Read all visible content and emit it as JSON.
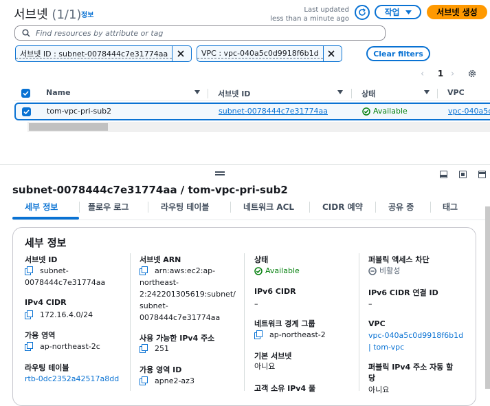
{
  "header": {
    "title": "서브넷",
    "count": "(1/1)",
    "info_link": "정보",
    "updated_line1": "Last updated",
    "updated_line2": "less than a minute ago",
    "actions_label": "작업",
    "create_label": "서브넷 생성"
  },
  "search": {
    "placeholder": "Find resources by attribute or tag"
  },
  "filters": {
    "tokens": [
      {
        "label": "서브넷 ID : subnet-0078444c7e31774aa"
      },
      {
        "label": "VPC : vpc-040a5c0d9918f6b1d"
      }
    ],
    "clear_label": "Clear filters"
  },
  "pagination": {
    "current_page": "1"
  },
  "table": {
    "columns": [
      "Name",
      "서브넷 ID",
      "상태",
      "VPC"
    ],
    "rows": [
      {
        "name": "tom-vpc-pri-sub2",
        "subnet_id": "subnet-0078444c7e31774aa",
        "state": "Available",
        "vpc": "vpc-040a5c"
      }
    ]
  },
  "detail": {
    "title": "subnet-0078444c7e31774aa / tom-vpc-pri-sub2",
    "tabs": [
      "세부 정보",
      "플로우 로그",
      "라우팅 테이블",
      "네트워크 ACL",
      "CIDR 예약",
      "공유 중",
      "태그"
    ],
    "section_title": "세부 정보",
    "col1": {
      "subnet_id_label": "서브넷 ID",
      "subnet_id_line1": "subnet-",
      "subnet_id_line2": "0078444c7e31774aa",
      "ipv4_cidr_label": "IPv4 CIDR",
      "ipv4_cidr": "172.16.4.0/24",
      "az_label": "가용 영역",
      "az": "ap-northeast-2c",
      "route_table_label": "라우팅 테이블",
      "route_table": "rtb-0dc2352a42517a8dd"
    },
    "col2": {
      "arn_label": "서브넷 ARN",
      "arn_line1": "arn:aws:ec2:ap-",
      "arn_line2": "northeast-",
      "arn_line3": "2:242201305619:subnet/",
      "arn_line4": "subnet-",
      "arn_line5": "0078444c7e31774aa",
      "avail_ipv4_label": "사용 가능한 IPv4 주소",
      "avail_ipv4": "251",
      "az_id_label": "가용 영역 ID",
      "az_id": "apne2-az3"
    },
    "col3": {
      "state_label": "상태",
      "state": "Available",
      "ipv6_cidr_label": "IPv6 CIDR",
      "ipv6_cidr": "–",
      "nbg_label": "네트워크 경계 그룹",
      "nbg": "ap-northeast-2",
      "default_subnet_label": "기본 서브넷",
      "default_subnet": "아니요",
      "cut_label": "고객 소유 IPv4 풀"
    },
    "col4": {
      "public_block_label": "퍼블릭 액세스 차단",
      "public_block": "비활성",
      "ipv6_assoc_label": "IPv6 CIDR 연결 ID",
      "ipv6_assoc": "–",
      "vpc_label": "VPC",
      "vpc_line1": "vpc-040a5c0d9918f6b1d",
      "vpc_line2": "| tom-vpc",
      "auto_ipv4_label_line1": "퍼블릭 IPv4 주소 자동 할",
      "auto_ipv4_label_line2": "당",
      "auto_ipv4_cut": "아니요"
    }
  },
  "colors": {
    "accent": "#0972d3",
    "primary": "#ff9900",
    "success": "#037f0c"
  }
}
